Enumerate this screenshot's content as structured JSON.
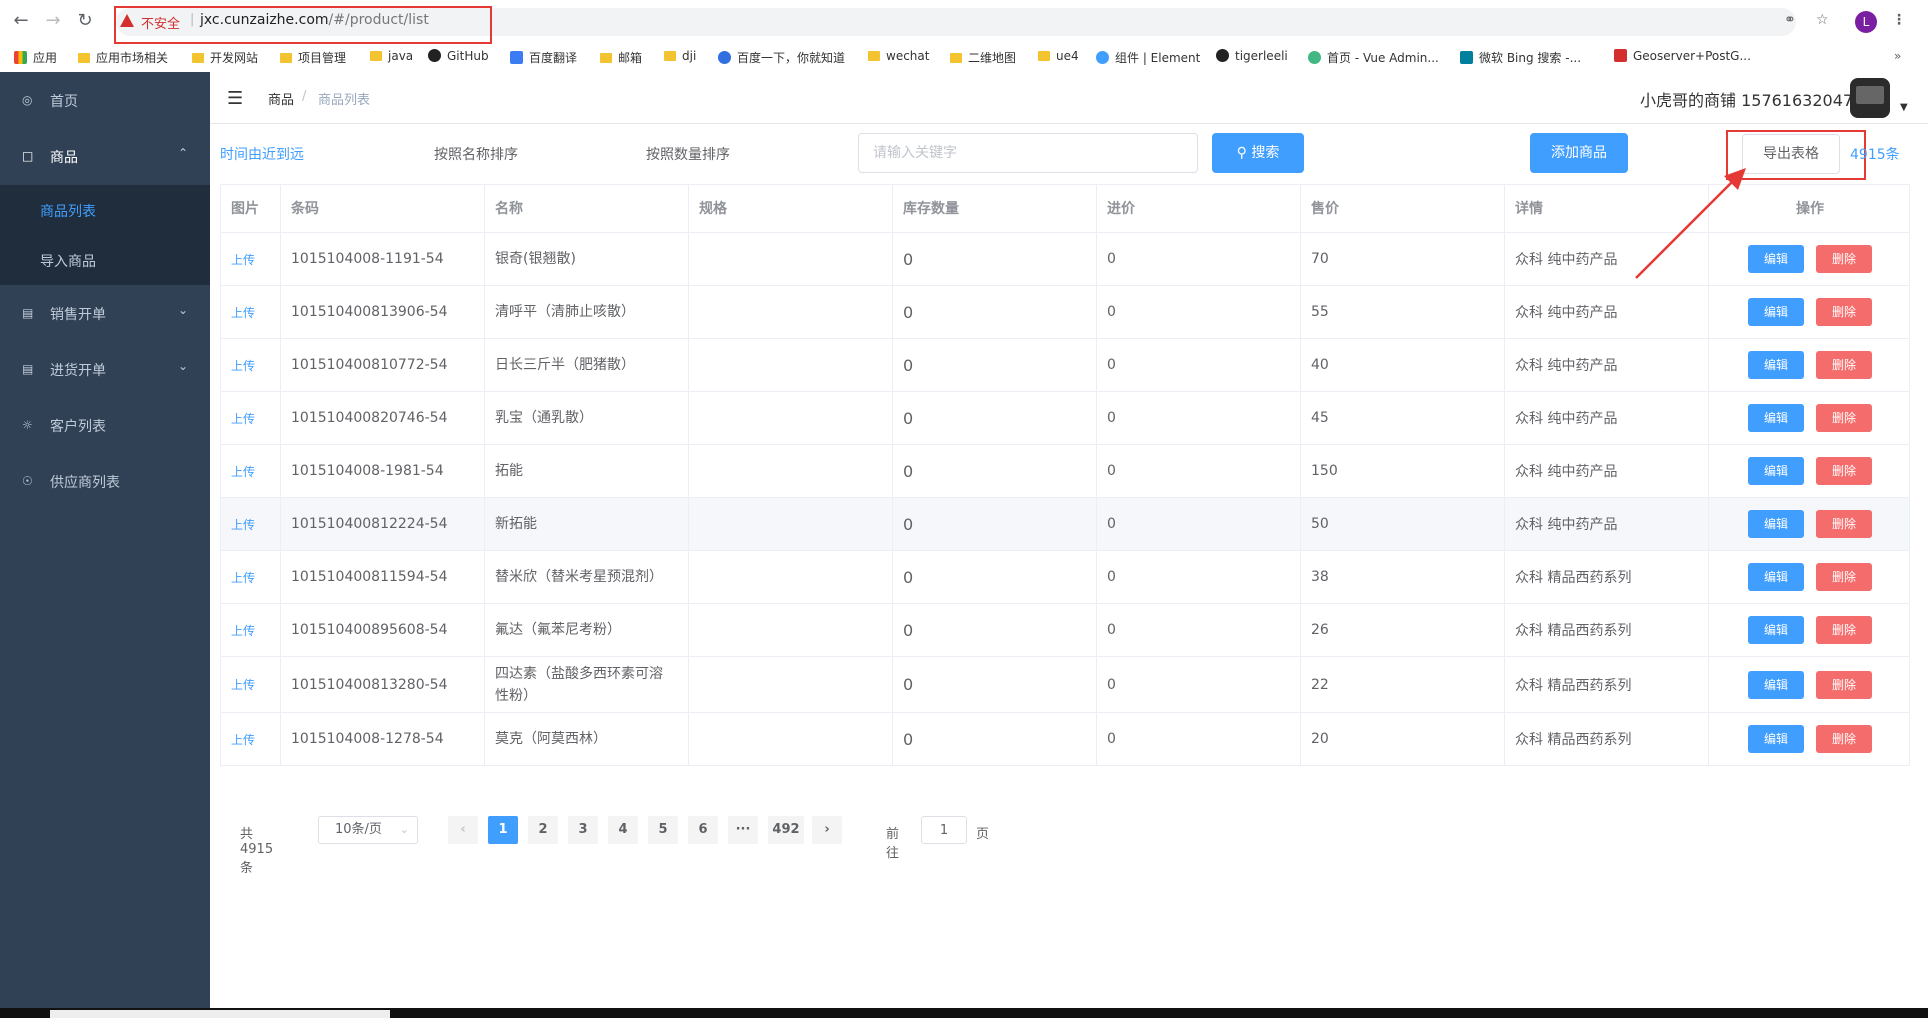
{
  "browser": {
    "security_label": "不安全",
    "url_host": "jxc.cunzaizhe.com",
    "url_path": "/#/product/list",
    "profile_letter": "L",
    "bookmarks": [
      "应用",
      "应用市场相关",
      "开发网站",
      "项目管理",
      "java",
      "GitHub",
      "百度翻译",
      "邮箱",
      "dji",
      "百度一下，你就知道",
      "wechat",
      "二维地图",
      "ue4",
      "组件 | Element",
      "tigerleeli",
      "首页 - Vue Admin...",
      "微软 Bing 搜索 -...",
      "Geoserver+PostG..."
    ]
  },
  "sidebar": {
    "items": [
      {
        "label": "首页",
        "icon": "dashboard-icon"
      },
      {
        "label": "商品",
        "icon": "shopping-bag-icon"
      },
      {
        "label": "销售开单",
        "icon": "sales-icon"
      },
      {
        "label": "进货开单",
        "icon": "purchase-icon"
      },
      {
        "label": "客户列表",
        "icon": "customer-icon"
      },
      {
        "label": "供应商列表",
        "icon": "supplier-icon"
      }
    ],
    "sub_items": [
      {
        "label": "商品列表",
        "active": true
      },
      {
        "label": "导入商品",
        "active": false
      }
    ]
  },
  "navbar": {
    "breadcrumb_root": "商品",
    "breadcrumb_current": "商品列表",
    "shop_name": "小虎哥的商铺 15761632047"
  },
  "toolbar": {
    "sort_time": "时间由近到远",
    "sort_name": "按照名称排序",
    "sort_qty": "按照数量排序",
    "search_placeholder": "请输入关键字",
    "search_label": "搜索",
    "add_label": "添加商品",
    "export_label": "导出表格",
    "count_label": "4915条"
  },
  "table": {
    "headers": [
      "图片",
      "条码",
      "名称",
      "规格",
      "库存数量",
      "进价",
      "售价",
      "详情",
      "操作"
    ],
    "upload_label": "上传",
    "edit_label": "编辑",
    "delete_label": "删除",
    "rows": [
      {
        "barcode": "1015104008-1191-54",
        "name": "银奇(银翘散)",
        "spec": "",
        "stock": "0",
        "cost": "0",
        "price": "70",
        "detail": "众科 纯中药产品"
      },
      {
        "barcode": "101510400813906-54",
        "name": "清呼平（清肺止咳散）",
        "spec": "",
        "stock": "0",
        "cost": "0",
        "price": "55",
        "detail": "众科 纯中药产品"
      },
      {
        "barcode": "101510400810772-54",
        "name": "日长三斤半（肥猪散）",
        "spec": "",
        "stock": "0",
        "cost": "0",
        "price": "40",
        "detail": "众科 纯中药产品"
      },
      {
        "barcode": "101510400820746-54",
        "name": "乳宝（通乳散）",
        "spec": "",
        "stock": "0",
        "cost": "0",
        "price": "45",
        "detail": "众科 纯中药产品"
      },
      {
        "barcode": "1015104008-1981-54",
        "name": "拓能",
        "spec": "",
        "stock": "0",
        "cost": "0",
        "price": "150",
        "detail": "众科 纯中药产品"
      },
      {
        "barcode": "101510400812224-54",
        "name": "新拓能",
        "spec": "",
        "stock": "0",
        "cost": "0",
        "price": "50",
        "detail": "众科 纯中药产品"
      },
      {
        "barcode": "101510400811594-54",
        "name": "替米欣（替米考星预混剂）",
        "spec": "",
        "stock": "0",
        "cost": "0",
        "price": "38",
        "detail": "众科 精品西药系列"
      },
      {
        "barcode": "101510400895608-54",
        "name": "氟达（氟苯尼考粉）",
        "spec": "",
        "stock": "0",
        "cost": "0",
        "price": "26",
        "detail": "众科 精品西药系列"
      },
      {
        "barcode": "101510400813280-54",
        "name": "四达素（盐酸多西环素可溶性粉）",
        "spec": "",
        "stock": "0",
        "cost": "0",
        "price": "22",
        "detail": "众科 精品西药系列"
      },
      {
        "barcode": "1015104008-1278-54",
        "name": "莫克（阿莫西林）",
        "spec": "",
        "stock": "0",
        "cost": "0",
        "price": "20",
        "detail": "众科 精品西药系列"
      }
    ]
  },
  "pagination": {
    "total_label": "共 4915 条",
    "page_size": "10条/页",
    "pages": [
      "1",
      "2",
      "3",
      "4",
      "5",
      "6",
      "···",
      "492"
    ],
    "current_page": "1",
    "goto_prefix": "前往",
    "goto_value": "1",
    "goto_suffix": "页"
  },
  "colors": {
    "sidebar_bg": "#304156",
    "submenu_bg": "#1f2d3d",
    "primary": "#409eff",
    "danger": "#f56c6c",
    "annotation": "#e53935"
  }
}
